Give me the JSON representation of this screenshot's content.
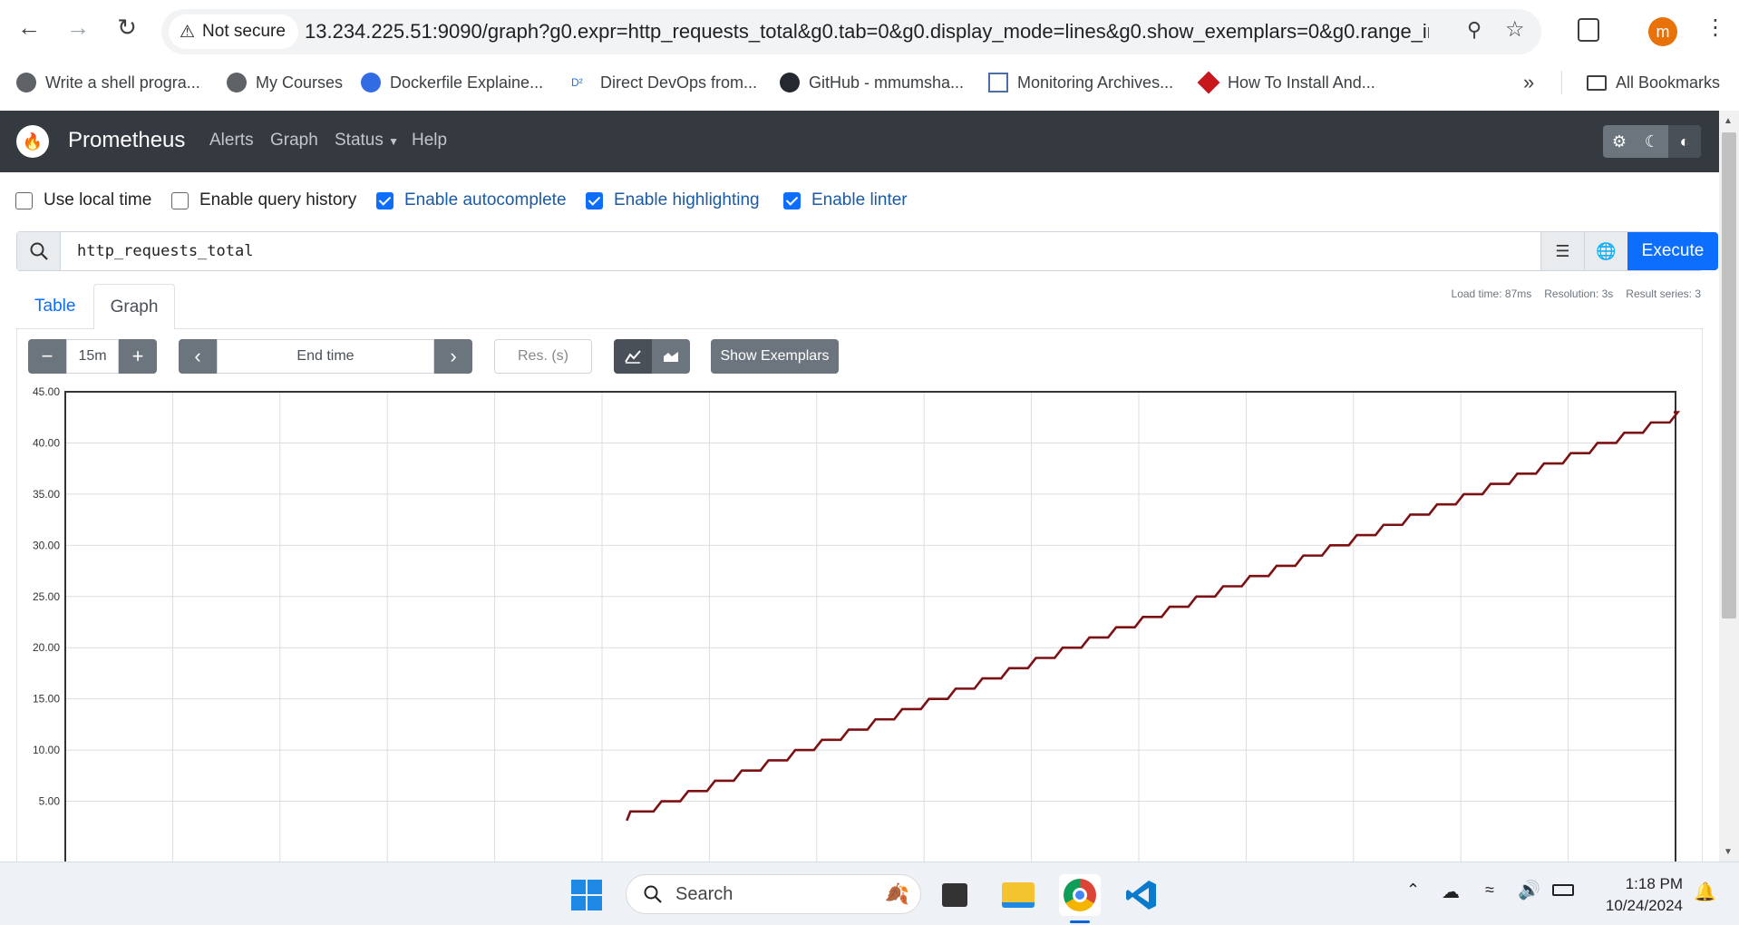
{
  "browser": {
    "security_label": "Not secure",
    "url": "13.234.225.51:9090/graph?g0.expr=http_requests_total&g0.tab=0&g0.display_mode=lines&g0.show_exemplars=0&g0.range_input=1...",
    "profile_initial": "m",
    "bookmarks": [
      {
        "label": "Write a shell progra...",
        "icon": "globe-icon"
      },
      {
        "label": "My Courses",
        "icon": "globe-icon"
      },
      {
        "label": "Dockerfile Explaine...",
        "icon": "kubernetes-icon"
      },
      {
        "label": "Direct DevOps from...",
        "icon": "d2-icon"
      },
      {
        "label": "GitHub - mmumsha...",
        "icon": "github-icon"
      },
      {
        "label": "Monitoring Archives...",
        "icon": "chart-icon"
      },
      {
        "label": "How To Install And...",
        "icon": "cube-icon"
      }
    ],
    "all_bookmarks": "All Bookmarks",
    "overflow_label": "»"
  },
  "navbar": {
    "brand": "Prometheus",
    "links": [
      "Alerts",
      "Graph",
      "Status",
      "Help"
    ]
  },
  "options": [
    {
      "label": "Use local time",
      "checked": false
    },
    {
      "label": "Enable query history",
      "checked": false
    },
    {
      "label": "Enable autocomplete",
      "checked": true
    },
    {
      "label": "Enable highlighting",
      "checked": true
    },
    {
      "label": "Enable linter",
      "checked": true
    }
  ],
  "query": {
    "expression": "http_requests_total",
    "execute_label": "Execute"
  },
  "tabs": {
    "table": "Table",
    "graph": "Graph"
  },
  "stats": {
    "load_time": "Load time: 87ms",
    "resolution": "Resolution: 3s",
    "result_series": "Result series: 3"
  },
  "controls": {
    "range": "15m",
    "minus": "−",
    "plus": "+",
    "end_time_placeholder": "End time",
    "res_placeholder": "Res. (s)",
    "show_exemplars": "Show Exemplars"
  },
  "chart_data": {
    "type": "line",
    "ylim": [
      0,
      45
    ],
    "yticks": [
      "45.00",
      "40.00",
      "35.00",
      "30.00",
      "25.00",
      "20.00",
      "15.00",
      "10.00",
      "5.00"
    ],
    "series": [
      {
        "color": "#7b1113",
        "start_value": 4,
        "end_value": 43
      }
    ],
    "grid": true
  },
  "taskbar": {
    "search_label": "Search",
    "time": "1:18 PM",
    "date": "10/24/2024"
  }
}
